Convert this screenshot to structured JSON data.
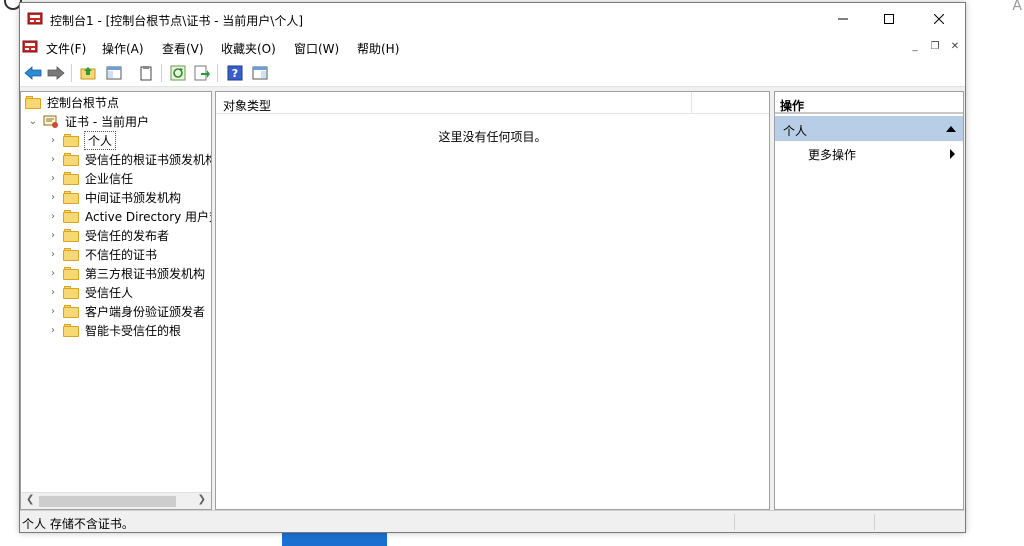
{
  "window": {
    "title": "控制台1 - [控制台根节点\\证书 - 当前用户\\个人]"
  },
  "menu": [
    "文件(F)",
    "操作(A)",
    "查看(V)",
    "收藏夹(O)",
    "窗口(W)",
    "帮助(H)"
  ],
  "toolbar_icons": [
    "back-arrow-icon",
    "forward-arrow-icon",
    "up-folder-icon",
    "show-hide-tree-icon",
    "properties-icon",
    "refresh-icon",
    "export-list-icon",
    "help-icon",
    "show-action-pane-icon"
  ],
  "tree": {
    "root": "控制台根节点",
    "snapin": "证书 - 当前用户",
    "items": [
      "个人",
      "受信任的根证书颁发机构",
      "企业信任",
      "中间证书颁发机构",
      "Active Directory 用户对象",
      "受信任的发布者",
      "不信任的证书",
      "第三方根证书颁发机构",
      "受信任人",
      "客户端身份验证颁发者",
      "智能卡受信任的根"
    ]
  },
  "list": {
    "column_header": "对象类型",
    "empty_message": "这里没有任何项目。"
  },
  "actions": {
    "header": "操作",
    "section": "个人",
    "more": "更多操作"
  },
  "status": {
    "text": "个人 存储不含证书。"
  },
  "colors": {
    "accent": "#1a6fd1",
    "action_section_bg": "#b8cde6",
    "folder": "#f8d775"
  }
}
